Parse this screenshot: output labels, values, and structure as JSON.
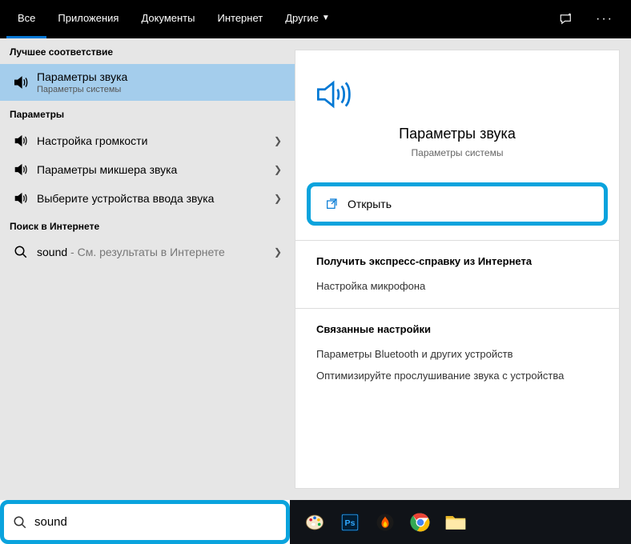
{
  "tabs": {
    "all": "Все",
    "apps": "Приложения",
    "documents": "Документы",
    "internet": "Интернет",
    "other": "Другие"
  },
  "sections": {
    "best_match": "Лучшее соответствие",
    "settings": "Параметры",
    "web_search": "Поиск в Интернете"
  },
  "results": {
    "best": {
      "title": "Параметры звука",
      "subtitle": "Параметры системы"
    },
    "settings": [
      {
        "title": "Настройка громкости"
      },
      {
        "title": "Параметры микшера звука"
      },
      {
        "title": "Выберите устройства ввода звука"
      }
    ],
    "web": {
      "query": "sound",
      "suffix": " - См. результаты в Интернете"
    }
  },
  "detail": {
    "title": "Параметры звука",
    "subtitle": "Параметры системы",
    "open": "Открыть",
    "help_header": "Получить экспресс-справку из Интернета",
    "help_links": [
      "Настройка микрофона"
    ],
    "related_header": "Связанные настройки",
    "related_links": [
      "Параметры Bluetooth и других устройств",
      "Оптимизируйте прослушивание звука с устройства"
    ]
  },
  "search": {
    "value": "sound"
  },
  "colors": {
    "accent": "#0078d4",
    "highlight": "#0aa3dd",
    "selected": "#a4cdec"
  }
}
